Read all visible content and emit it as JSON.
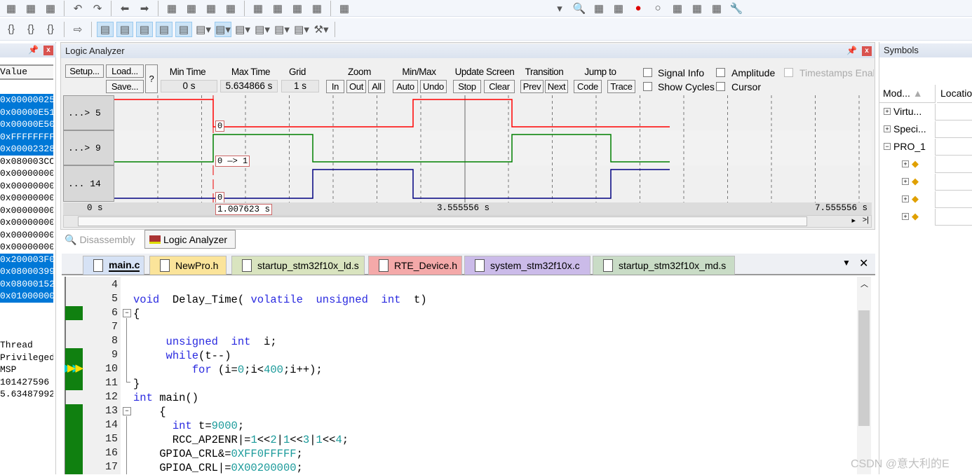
{
  "toolbar1": {
    "icons": [
      "cut-icon",
      "copy-icon",
      "paste-icon",
      "undo-icon",
      "redo-icon",
      "navigate-back-icon",
      "navigate-forward-icon",
      "bookmark-icon",
      "prev-bookmark-icon",
      "next-bookmark-icon",
      "clear-bookmarks-icon",
      "indent-icon",
      "unindent-icon",
      "comment-icon",
      "uncomment-icon",
      "find-in-files-icon"
    ],
    "right_icons": [
      "dropdown-icon",
      "find-icon",
      "debug-icon",
      "debug-session-icon",
      "breakpoint-icon",
      "disable-breakpoint-icon",
      "disable-all-breakpoints-icon",
      "kill-breakpoints-icon",
      "window-layout-icon",
      "configure-icon"
    ]
  },
  "toolbar2": {
    "icons": [
      "step-icon",
      "step-over-icon",
      "step-out-icon",
      "run-to-cursor-icon",
      "command-window-icon",
      "disassembly-window-icon",
      "symbols-window-icon",
      "registers-window-icon",
      "call-stack-icon",
      "watch-window-icon",
      "memory-window-icon",
      "serial-window-icon",
      "analysis-window-icon",
      "trace-window-icon",
      "system-viewer-icon",
      "toolbox-icon"
    ]
  },
  "registers": {
    "column_header": "Value",
    "values": [
      {
        "v": "0x00000025",
        "sel": true
      },
      {
        "v": "0x00000E51",
        "sel": true
      },
      {
        "v": "0x00000E50",
        "sel": true
      },
      {
        "v": "0xFFFFFFFF",
        "sel": true
      },
      {
        "v": "0x00002328",
        "sel": true
      },
      {
        "v": "0x080003CC",
        "sel": false
      },
      {
        "v": "0x00000000",
        "sel": false
      },
      {
        "v": "0x00000000",
        "sel": false
      },
      {
        "v": "0x00000000",
        "sel": false
      },
      {
        "v": "0x00000000",
        "sel": false
      },
      {
        "v": "0x00000000",
        "sel": false
      },
      {
        "v": "0x00000000",
        "sel": false
      },
      {
        "v": "0x00000000",
        "sel": false
      },
      {
        "v": "0x200003F0",
        "sel": true
      },
      {
        "v": "0x08000399",
        "sel": true
      },
      {
        "v": "0x08000152",
        "sel": true
      },
      {
        "v": "0x01000000",
        "sel": true
      }
    ],
    "internal": [
      "Thread",
      "Privileged",
      "MSP",
      "101427596",
      "5.63487992"
    ]
  },
  "logic_analyzer": {
    "title": "Logic Analyzer",
    "setup": "Setup...",
    "load": "Load...",
    "save": "Save...",
    "help": "?",
    "min_time_label": "Min Time",
    "min_time": "0 s",
    "max_time_label": "Max Time",
    "max_time": "5.634866 s",
    "grid_label": "Grid",
    "grid": "1 s",
    "zoom_label": "Zoom",
    "zoom_in": "In",
    "zoom_out": "Out",
    "zoom_all": "All",
    "minmax_label": "Min/Max",
    "auto": "Auto",
    "undo": "Undo",
    "update_label": "Update Screen",
    "stop": "Stop",
    "clear": "Clear",
    "transition_label": "Transition",
    "prev": "Prev",
    "next": "Next",
    "jump_label": "Jump to",
    "code": "Code",
    "trace": "Trace",
    "signal_info": "Signal Info",
    "amplitude": "Amplitude",
    "timestamps": "Timestamps Enab",
    "show_cycles": "Show Cycles",
    "cursor": "Cursor",
    "signals": [
      {
        "name": "...> 5",
        "color": "#ff0000",
        "value": "0"
      },
      {
        "name": "...> 9",
        "color": "#008000",
        "value": "0 —> 1"
      },
      {
        "name": "... 14",
        "color": "#000080",
        "value": "0"
      }
    ],
    "time_start": "0 s",
    "cursor_time": "1.007623 s",
    "time_mid": "3.555556 s",
    "time_end": "7.555556 s"
  },
  "bottom_tabs": {
    "disassembly": "Disassembly",
    "logic": "Logic Analyzer"
  },
  "editor_tabs": [
    {
      "label": "main.c",
      "color": "#d6e2f5"
    },
    {
      "label": "NewPro.h",
      "color": "#fbe49a"
    },
    {
      "label": "startup_stm32f10x_ld.s",
      "color": "#d9e4bf"
    },
    {
      "label": "RTE_Device.h",
      "color": "#f4a9a9"
    },
    {
      "label": "system_stm32f10x.c",
      "color": "#cbbbe9"
    },
    {
      "label": "startup_stm32f10x_md.s",
      "color": "#c9dcc6"
    }
  ],
  "code": [
    {
      "n": "4",
      "t": []
    },
    {
      "n": "5",
      "t": [
        [
          "kw",
          "void"
        ],
        [
          "tx",
          "  Delay_Time( "
        ],
        [
          "kw",
          "volatile"
        ],
        [
          "tx",
          "  "
        ],
        [
          "kw",
          "unsigned"
        ],
        [
          "tx",
          "  "
        ],
        [
          "kw",
          "int"
        ],
        [
          "tx",
          "  t)"
        ]
      ]
    },
    {
      "n": "6",
      "t": [
        [
          "tx",
          "{"
        ]
      ]
    },
    {
      "n": "7",
      "t": []
    },
    {
      "n": "8",
      "t": [
        [
          "tx",
          "     "
        ],
        [
          "kw",
          "unsigned"
        ],
        [
          "tx",
          "  "
        ],
        [
          "kw",
          "int"
        ],
        [
          "tx",
          "  i;"
        ]
      ]
    },
    {
      "n": "9",
      "t": [
        [
          "tx",
          "     "
        ],
        [
          "kw",
          "while"
        ],
        [
          "tx",
          "(t--)"
        ]
      ]
    },
    {
      "n": "10",
      "t": [
        [
          "tx",
          "         "
        ],
        [
          "kw",
          "for"
        ],
        [
          "tx",
          " (i="
        ],
        [
          "num",
          "0"
        ],
        [
          "tx",
          ";i<"
        ],
        [
          "num",
          "400"
        ],
        [
          "tx",
          ";i++);"
        ]
      ]
    },
    {
      "n": "11",
      "t": [
        [
          "tx",
          "}"
        ]
      ]
    },
    {
      "n": "12",
      "t": [
        [
          "kw",
          "int"
        ],
        [
          "tx",
          " main()"
        ]
      ]
    },
    {
      "n": "13",
      "t": [
        [
          "tx",
          "    {"
        ]
      ]
    },
    {
      "n": "14",
      "t": [
        [
          "tx",
          "      "
        ],
        [
          "kw",
          "int"
        ],
        [
          "tx",
          " t="
        ],
        [
          "num",
          "9000"
        ],
        [
          "tx",
          ";"
        ]
      ]
    },
    {
      "n": "15",
      "t": [
        [
          "tx",
          "      RCC_AP2ENR|="
        ],
        [
          "num",
          "1"
        ],
        [
          "tx",
          "<<"
        ],
        [
          "num",
          "2"
        ],
        [
          "tx",
          "|"
        ],
        [
          "num",
          "1"
        ],
        [
          "tx",
          "<<"
        ],
        [
          "num",
          "3"
        ],
        [
          "tx",
          "|"
        ],
        [
          "num",
          "1"
        ],
        [
          "tx",
          "<<"
        ],
        [
          "num",
          "4"
        ],
        [
          "tx",
          ";"
        ]
      ]
    },
    {
      "n": "16",
      "t": [
        [
          "tx",
          "    GPIOA_CRL&="
        ],
        [
          "num",
          "0XFF0FFFFF"
        ],
        [
          "tx",
          ";"
        ]
      ]
    },
    {
      "n": "17",
      "t": [
        [
          "tx",
          "    GPIOA_CRL|="
        ],
        [
          "num",
          "0X00200000"
        ],
        [
          "tx",
          ";"
        ]
      ]
    }
  ],
  "symbols": {
    "title": "Symbols",
    "col_module": "Mod...",
    "col_location": "Locatio",
    "items": [
      "Virtu...",
      "Speci...",
      "PRO_1"
    ]
  },
  "watermark": "CSDN @意大利的E"
}
